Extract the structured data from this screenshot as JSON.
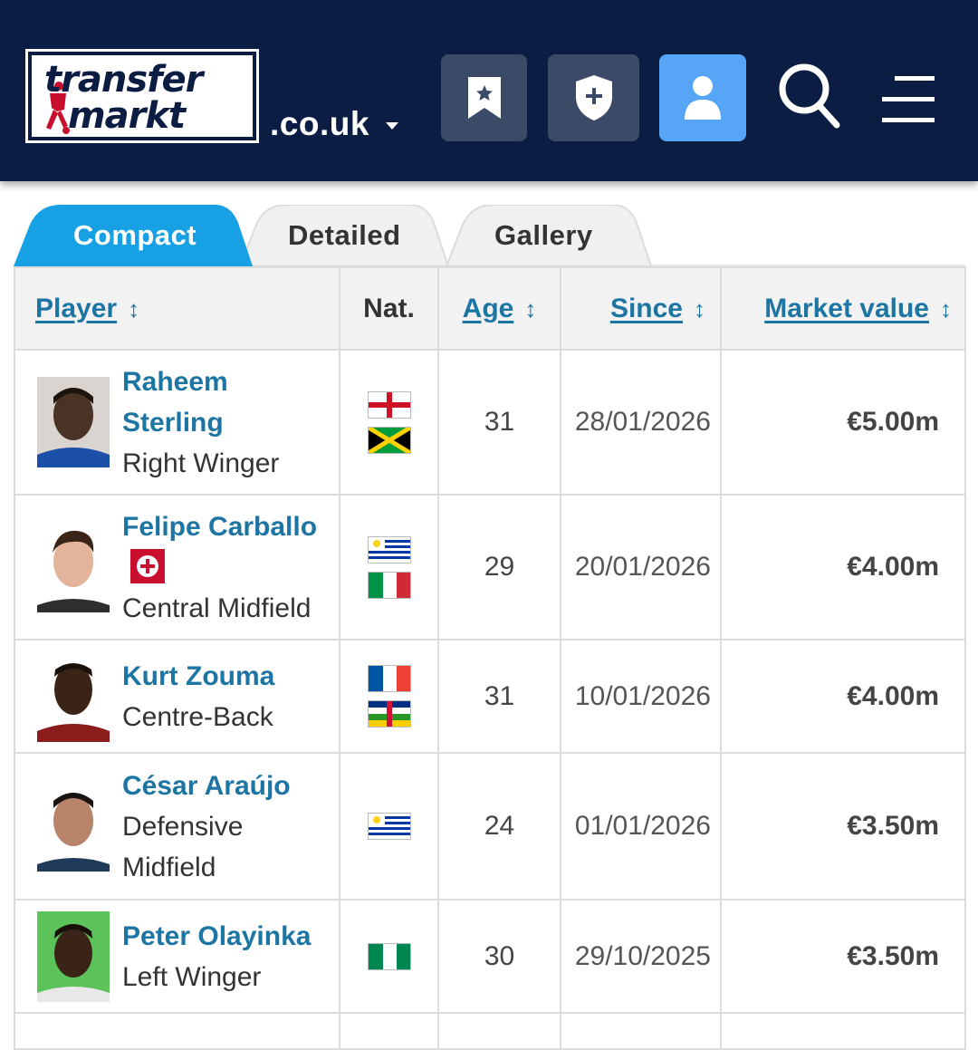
{
  "header": {
    "logo_line1": "transfer",
    "logo_line2": "markt",
    "domain": ".co.uk",
    "colors": {
      "background": "#0b1d42",
      "button_dark": "#3b4a66",
      "button_active": "#56a5f7"
    },
    "icons": [
      "bookmark-star-icon",
      "shield-plus-icon",
      "user-icon",
      "search-icon",
      "menu-icon"
    ]
  },
  "tabs": [
    {
      "label": "Compact",
      "active": true
    },
    {
      "label": "Detailed",
      "active": false
    },
    {
      "label": "Gallery",
      "active": false
    }
  ],
  "table": {
    "headers": {
      "player": "Player",
      "nat": "Nat.",
      "age": "Age",
      "since": "Since",
      "market_value": "Market value",
      "sort_glyph": "↕"
    },
    "rows": [
      {
        "name_line1": "Raheem",
        "name_line2": "Sterling",
        "position": "Right Winger",
        "nationalities": [
          "England",
          "Jamaica"
        ],
        "age": "31",
        "since": "28/01/2026",
        "market_value": "€5.00m"
      },
      {
        "name": "Felipe Carballo",
        "loan_badge": true,
        "position": "Central Midfield",
        "nationalities": [
          "Uruguay",
          "Italy"
        ],
        "age": "29",
        "since": "20/01/2026",
        "market_value": "€4.00m"
      },
      {
        "name": "Kurt Zouma",
        "position": "Centre-Back",
        "nationalities": [
          "France",
          "Central African Republic"
        ],
        "age": "31",
        "since": "10/01/2026",
        "market_value": "€4.00m"
      },
      {
        "name": "César Araújo",
        "position_line1": "Defensive",
        "position_line2": "Midfield",
        "nationalities": [
          "Uruguay"
        ],
        "age": "24",
        "since": "01/01/2026",
        "market_value": "€3.50m"
      },
      {
        "name": "Peter Olayinka",
        "position": "Left Winger",
        "nationalities": [
          "Nigeria"
        ],
        "age": "30",
        "since": "29/10/2025",
        "market_value": "€3.50m"
      }
    ]
  }
}
